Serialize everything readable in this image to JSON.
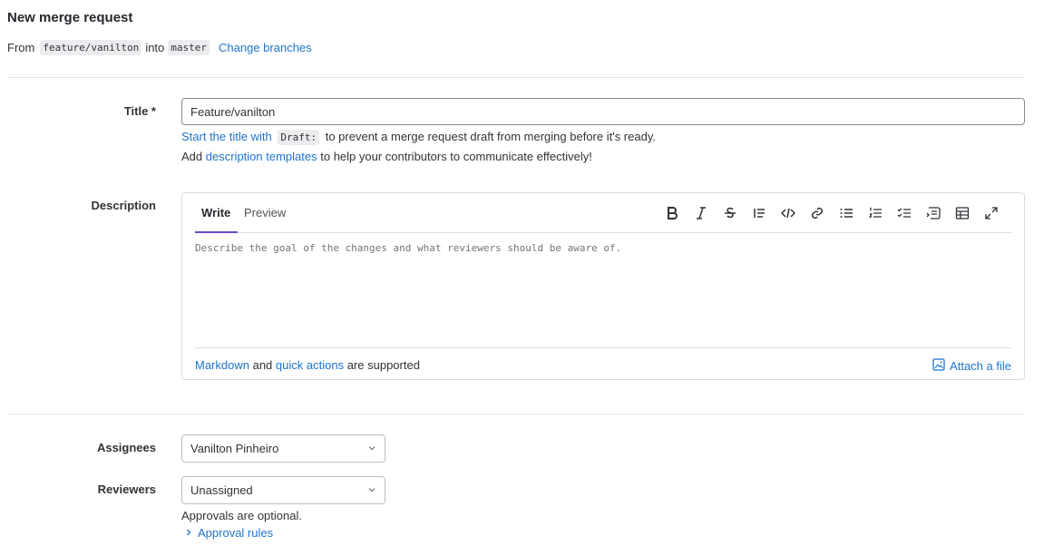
{
  "header": {
    "title": "New merge request",
    "from_label": "From",
    "source_branch": "feature/vanilton",
    "into_label": "into",
    "target_branch": "master",
    "change_branches": "Change branches"
  },
  "title_field": {
    "label": "Title *",
    "value": "Feature/vanilton",
    "help_prefix_link": "Start the title with",
    "help_code": "Draft:",
    "help_suffix": "to prevent a merge request draft from merging before it's ready.",
    "templates_prefix": "Add",
    "templates_link": "description templates",
    "templates_suffix": "to help your contributors to communicate effectively!"
  },
  "description": {
    "label": "Description",
    "tabs": [
      "Write",
      "Preview"
    ],
    "placeholder": "Describe the goal of the changes and what reviewers should be aware of.",
    "toolbar_icons": [
      "bold-icon",
      "italic-icon",
      "strikethrough-icon",
      "quote-icon",
      "code-icon",
      "link-icon",
      "bullet-list-icon",
      "numbered-list-icon",
      "task-list-icon",
      "collapsible-section-icon",
      "table-icon",
      "fullscreen-icon"
    ],
    "footer_markdown": "Markdown",
    "footer_and": "and",
    "footer_quick_actions": "quick actions",
    "footer_supported": "are supported",
    "attach_file": "Attach a file"
  },
  "assignees": {
    "label": "Assignees",
    "value": "Vanilton Pinheiro"
  },
  "reviewers": {
    "label": "Reviewers",
    "value": "Unassigned",
    "approvals_note": "Approvals are optional.",
    "approval_rules": "Approval rules"
  },
  "colors": {
    "link": "#1f75cb",
    "active_tab": "#6e49cb",
    "text": "#333238",
    "border": "#dcdcde"
  }
}
